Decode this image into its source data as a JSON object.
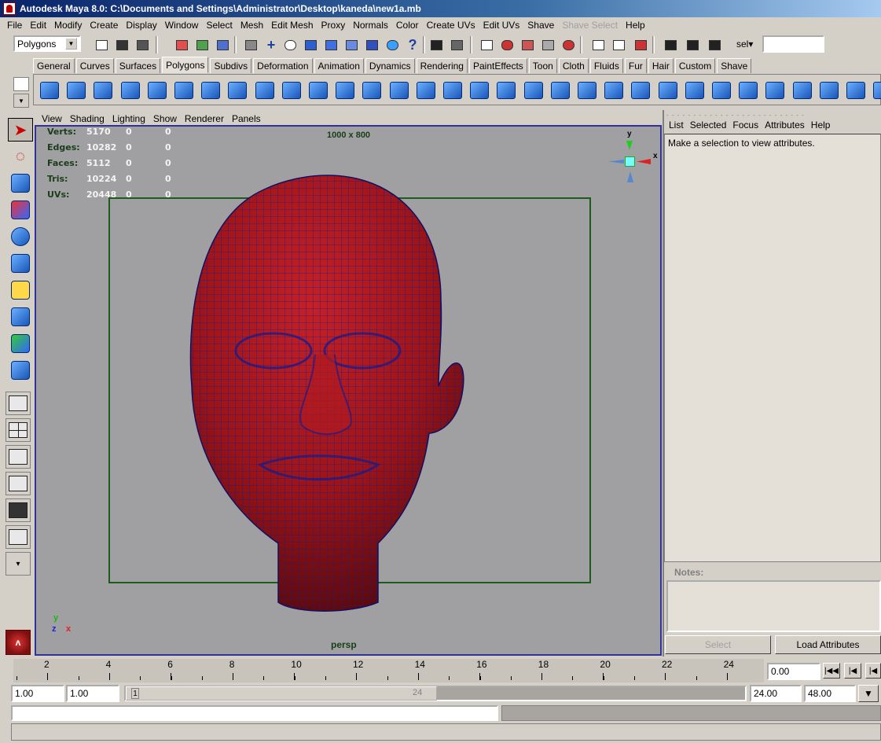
{
  "window": {
    "title": "Autodesk Maya 8.0: C:\\Documents and Settings\\Administrator\\Desktop\\kaneda\\new1a.mb"
  },
  "menubar": [
    "File",
    "Edit",
    "Modify",
    "Create",
    "Display",
    "Window",
    "Select",
    "Mesh",
    "Edit Mesh",
    "Proxy",
    "Normals",
    "Color",
    "Create UVs",
    "Edit UVs",
    "Shave",
    "Shave Select",
    "Help"
  ],
  "menubar_disabled": "Shave Select",
  "statusline": {
    "menu_set": "Polygons",
    "sel_label": "sel",
    "sel_value": ""
  },
  "shelf_tabs": [
    "General",
    "Curves",
    "Surfaces",
    "Polygons",
    "Subdivs",
    "Deformation",
    "Animation",
    "Dynamics",
    "Rendering",
    "PaintEffects",
    "Toon",
    "Cloth",
    "Fluids",
    "Fur",
    "Hair",
    "Custom",
    "Shave"
  ],
  "shelf_active": "Polygons",
  "panel_menu": [
    "View",
    "Shading",
    "Lighting",
    "Show",
    "Renderer",
    "Panels"
  ],
  "hud": {
    "rows": [
      {
        "label": "Verts:",
        "a": "5170",
        "b": "0",
        "c": "0"
      },
      {
        "label": "Edges:",
        "a": "10282",
        "b": "0",
        "c": "0"
      },
      {
        "label": "Faces:",
        "a": "5112",
        "b": "0",
        "c": "0"
      },
      {
        "label": "Tris:",
        "a": "10224",
        "b": "0",
        "c": "0"
      },
      {
        "label": "UVs:",
        "a": "20448",
        "b": "0",
        "c": "0"
      }
    ],
    "resolution": "1000 x 800",
    "camera": "persp",
    "axis_y": "y",
    "axis_x": "x",
    "axis_z": "z"
  },
  "attribute_editor": {
    "menu": [
      "List",
      "Selected",
      "Focus",
      "Attributes",
      "Help"
    ],
    "message": "Make a selection to view attributes.",
    "notes_label": "Notes:",
    "select_button": "Select",
    "load_button": "Load Attributes"
  },
  "timeline": {
    "ticks": [
      "2",
      "4",
      "6",
      "8",
      "10",
      "12",
      "14",
      "16",
      "18",
      "20",
      "22",
      "24"
    ],
    "current_time": "0.00"
  },
  "range": {
    "start": "1.00",
    "playback_start": "1.00",
    "range_marker_start": "1",
    "range_marker_end": "24",
    "playback_end": "24.00",
    "end": "48.00"
  },
  "colors": {
    "head": "#9b1418",
    "wire": "#1c1c8a",
    "viewport": "#a0a0a2",
    "gate": "#1d5a1d"
  }
}
